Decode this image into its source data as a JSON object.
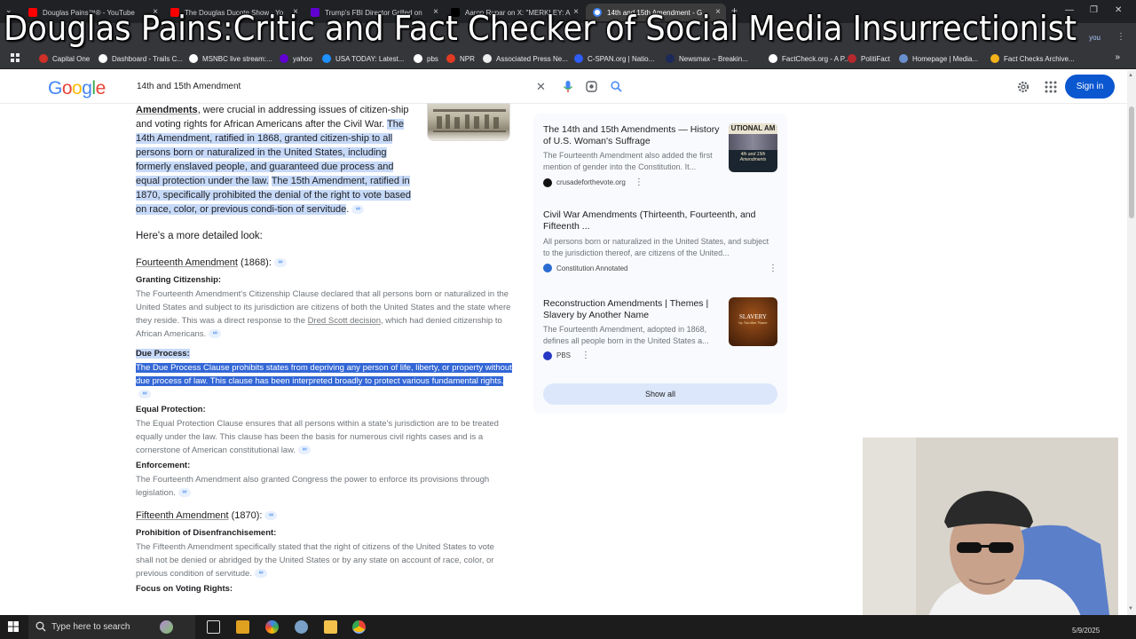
{
  "overlay_title": "Douglas Pains:Critic and Fact Checker of Social Media Insurrectionist",
  "browser": {
    "tabs": [
      {
        "title": "Douglas Pains™® - YouTube",
        "color": "#ff0000"
      },
      {
        "title": "The Douglas Ducote Show - Yo",
        "color": "#ff0000"
      },
      {
        "title": "Trump's FBI Director Grilled on",
        "color": "#6001d2"
      },
      {
        "title": "Aaron Rupar on X: \"MERKLEY: A",
        "color": "#000000"
      },
      {
        "title": "14th and 15th Amendment - G",
        "color": "#4285f4",
        "active": true
      }
    ],
    "tab_close_glyph": "×",
    "new_tab_glyph": "+",
    "signed_in_text": "you",
    "bookmarks": [
      {
        "label": "Capital One",
        "color": "#d03027"
      },
      {
        "label": "Dashboard - Trails C...",
        "color": "#ffffff"
      },
      {
        "label": "MSNBC live stream:...",
        "color": "#ffffff"
      },
      {
        "label": "yahoo",
        "color": "#6001d2"
      },
      {
        "label": "USA TODAY: Latest...",
        "color": "#1e90ff"
      },
      {
        "label": "pbs",
        "color": "#ffffff"
      },
      {
        "label": "NPR",
        "color": "#e03b22"
      },
      {
        "label": "Associated Press Ne...",
        "color": "#eeeeee"
      },
      {
        "label": "C-SPAN.org | Natio...",
        "color": "#2f5ef7"
      },
      {
        "label": "Newsmax – Breakin...",
        "color": "#1c2a5a"
      },
      {
        "label": "FactCheck.org - A P...",
        "color": "#ffffff"
      },
      {
        "label": "PolitiFact",
        "color": "#b5282e"
      },
      {
        "label": "Homepage | Media...",
        "color": "#6a8fcf"
      },
      {
        "label": "Fact Checks Archive...",
        "color": "#f3b21a"
      }
    ],
    "bookmarks_more": "»"
  },
  "google": {
    "logo_letters": [
      {
        "c": "G",
        "color": "#4285f4"
      },
      {
        "c": "o",
        "color": "#ea4335"
      },
      {
        "c": "o",
        "color": "#fbbc05"
      },
      {
        "c": "g",
        "color": "#4285f4"
      },
      {
        "c": "l",
        "color": "#34a853"
      },
      {
        "c": "e",
        "color": "#ea4335"
      }
    ],
    "search_query": "14th and 15th Amendment",
    "clear_glyph": "✕",
    "signin_label": "Sign in"
  },
  "answer": {
    "intro_prefix": "Amendments",
    "intro_rest": ", were crucial in addressing issues of citizen-ship and voting rights for African Americans after the Civil War. ",
    "intro_sel1": "The 14th Amendment, ratified in 1868, granted citizen-ship to all persons born or naturalized in the United States, including formerly enslaved people, and guaranteed due process and equal protection under the law.",
    "intro_sel2": "The 15th Amendment, ratified in 1870, specifically prohibited the denial of the right to vote based on race, color, or previous condi-tion of servitude",
    "intro_end": ".",
    "detail_heading": "Here's a more detailed look:",
    "fourteenth": {
      "title": "Fourteenth Amendment",
      "year": " (1868):",
      "items": [
        {
          "title": "Granting Citizenship:",
          "body": "The Fourteenth Amendment's Citizenship Clause declared that all persons born or naturalized in the United States and subject to its jurisdiction are citizens of both the United States and the state where they reside. This was a direct response to the ",
          "link": "Dred Scott decision",
          "body_after": ", which had denied citizenship to African Americans."
        },
        {
          "title": "Due Process:",
          "body": "The Due Process Clause prohibits states from depriving any person of life, liberty, or property without due process of law. This clause has been interpreted broadly to protect various fundamental rights.",
          "highlight": true
        },
        {
          "title": "Equal Protection:",
          "body": "The Equal Protection Clause ensures that all persons within a state's jurisdiction are to be treated equally under the law. This clause has been the basis for numerous civil rights cases and is a cornerstone of American constitutional law."
        },
        {
          "title": "Enforcement:",
          "body": "The Fourteenth Amendment also granted Congress the power to enforce its provisions through legislation."
        }
      ]
    },
    "fifteenth": {
      "title": "Fifteenth Amendment",
      "year": " (1870):",
      "items": [
        {
          "title": "Prohibition of Disenfranchisement:",
          "body": "The Fifteenth Amendment specifically stated that the right of citizens of the United States to vote shall not be denied or abridged by the United States or by any state on account of race, color, or previous condition of servitude."
        },
        {
          "title": "Focus on Voting Rights:",
          "body": ""
        }
      ]
    }
  },
  "sources": {
    "items": [
      {
        "title": "The 14th and 15th Amendments — History of U.S. Woman's Suffrage",
        "desc": "The Fourteenth Amendment also added the first mention of gender into the Constitution. It...",
        "site": "crusadeforthevote.org",
        "site_color": "#111111",
        "thumb_text": "UTIONAL AM",
        "thumb_sub": "4th and 15th Amendments",
        "thumb_bg": "#1a2530"
      },
      {
        "title": "Civil War Amendments (Thirteenth, Fourteenth, and Fifteenth ...",
        "desc": "All persons born or naturalized in the United States, and subject to the jurisdiction thereof, are citizens of the United...",
        "site": "Constitution Annotated",
        "site_color": "#2a6bd1"
      },
      {
        "title": "Reconstruction Amendments | Themes | Slavery by Another Name",
        "desc": "The Fourteenth Amendment, adopted in 1868, defines all people born in the United States a...",
        "site": "PBS",
        "site_color": "#2638c4",
        "thumb_text": "SLAVERY",
        "thumb_sub": "by Another Name",
        "thumb_bg": "#3a1a08"
      }
    ],
    "show_all": "Show all"
  },
  "taskbar": {
    "search_placeholder": "Type here to search",
    "date": "5/9/2025"
  }
}
